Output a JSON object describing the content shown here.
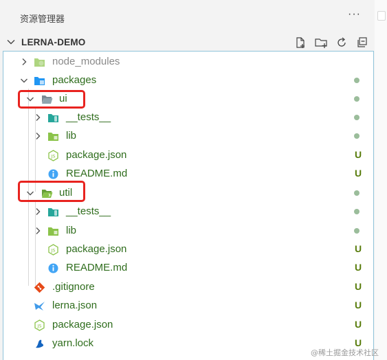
{
  "panel": {
    "title": "资源管理器",
    "more": "···"
  },
  "section": {
    "label": "LERNA-DEMO"
  },
  "toolbar": {
    "icons": [
      "new-file-icon",
      "new-folder-icon",
      "refresh-icon",
      "collapse-all-icon"
    ]
  },
  "tree": [
    {
      "name": "node_modules",
      "status": "",
      "dim": true
    },
    {
      "name": "packages",
      "status": "dot"
    },
    {
      "name": "ui",
      "status": "dot"
    },
    {
      "name": "__tests__",
      "status": "dot"
    },
    {
      "name": "lib",
      "status": "dot"
    },
    {
      "name": "package.json",
      "status": "U"
    },
    {
      "name": "README.md",
      "status": "U"
    },
    {
      "name": "util",
      "status": "dot"
    },
    {
      "name": "__tests__",
      "status": "dot"
    },
    {
      "name": "lib",
      "status": "dot"
    },
    {
      "name": "package.json",
      "status": "U"
    },
    {
      "name": "README.md",
      "status": "U"
    },
    {
      "name": ".gitignore",
      "status": "U"
    },
    {
      "name": "lerna.json",
      "status": "U"
    },
    {
      "name": "package.json",
      "status": "U"
    },
    {
      "name": "yarn.lock",
      "status": "U"
    }
  ],
  "watermark": "@稀土掘金技术社区",
  "colors": {
    "status_untracked": "#587c0c",
    "highlight": "#e8231f",
    "focus_border": "#8fc4da"
  }
}
